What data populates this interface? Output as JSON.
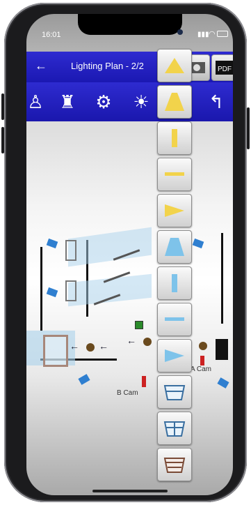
{
  "status": {
    "time": "16:01"
  },
  "nav": {
    "title": "Lighting Plan - 2/2"
  },
  "tools": [
    "person-tool-icon",
    "character-tool-icon",
    "camera-dolly-tool-icon",
    "lighting-tool-icon",
    "light-burst-tool-icon",
    "undo-tool-icon"
  ],
  "plan_labels": {
    "a_cam": "A Cam",
    "b_cam": "B Cam"
  },
  "colors": {
    "nav_bar": "#2e2bd0",
    "lamp": "#2f7fd0",
    "panel_yellow": "#f2d34b"
  }
}
